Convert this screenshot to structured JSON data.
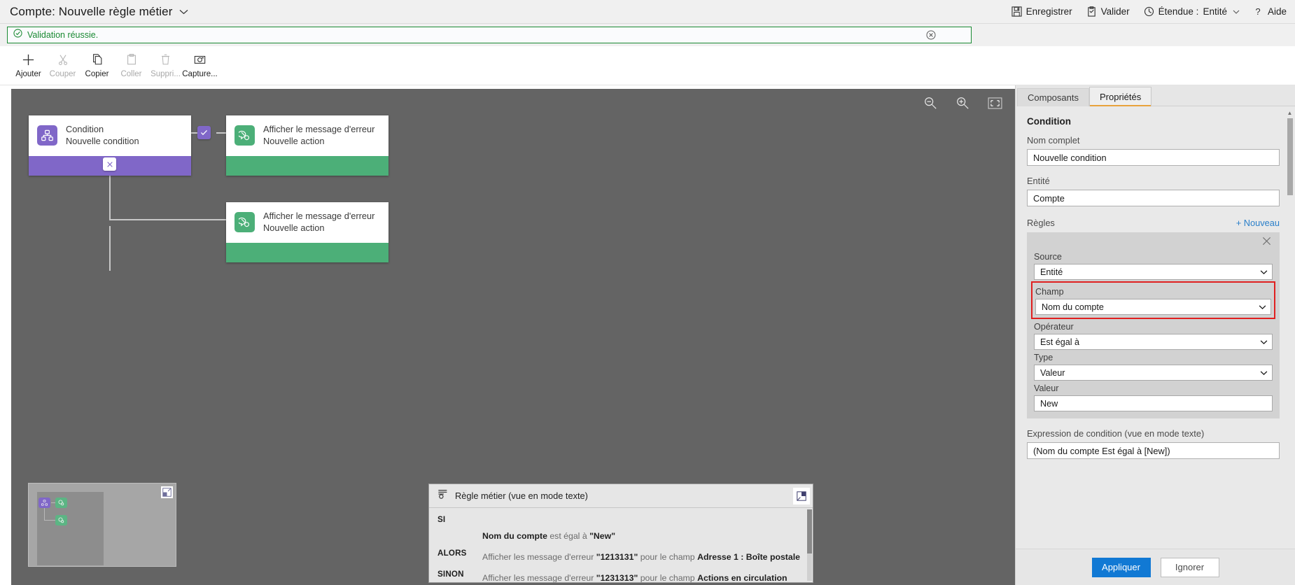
{
  "titlebar": {
    "title": "Compte: Nouvelle règle métier",
    "chevron": "chevron-down",
    "actions": [
      {
        "label": "Enregistrer",
        "icon": "save-icon"
      },
      {
        "label": "Valider",
        "icon": "validate-icon"
      },
      {
        "label": "Étendue :",
        "icon": "scope-icon",
        "value": "Entité",
        "chevron": "chevron-down"
      },
      {
        "label": "Aide",
        "icon": "help-icon"
      }
    ]
  },
  "validation": {
    "message": "Validation réussie.",
    "icon": "check-circle-icon",
    "close_icon": "close-circle-icon",
    "border_color": "#1a8a33",
    "text_color": "#1a8a33"
  },
  "commandbar": {
    "buttons": [
      {
        "label": "Ajouter",
        "icon": "plus-icon",
        "disabled": false
      },
      {
        "label": "Couper",
        "icon": "scissors-icon",
        "disabled": true
      },
      {
        "label": "Copier",
        "icon": "copy-icon",
        "disabled": false
      },
      {
        "label": "Coller",
        "icon": "paste-icon",
        "disabled": true
      },
      {
        "label": "Suppri...",
        "icon": "trash-icon",
        "disabled": true
      },
      {
        "label": "Capture...",
        "icon": "camera-icon",
        "disabled": false
      }
    ]
  },
  "canvas": {
    "background": "#646464",
    "tools": [
      {
        "name": "zoom-out-icon"
      },
      {
        "name": "zoom-in-icon"
      },
      {
        "name": "fit-to-screen-icon"
      }
    ],
    "nodes": [
      {
        "type": "condition",
        "icon": "condition-icon",
        "color": "#8067c8",
        "line1": "Condition",
        "line2": "Nouvelle condition"
      },
      {
        "type": "action",
        "icon": "show-error-message-icon",
        "color": "#4caf78",
        "line1": "Afficher le message d'erreur",
        "line2": "Nouvelle action"
      },
      {
        "type": "action",
        "icon": "show-error-message-icon",
        "color": "#4caf78",
        "line1": "Afficher le message d'erreur",
        "line2": "Nouvelle action"
      }
    ],
    "branch_badges": [
      {
        "name": "branch-true-badge",
        "glyph": "check"
      },
      {
        "name": "branch-false-badge",
        "glyph": "cross"
      }
    ]
  },
  "minimap": {
    "restore_icon": "restore-icon"
  },
  "textpanel": {
    "icon": "business-rule-icon",
    "title": "Règle métier (vue en mode texte)",
    "restore_icon": "restore-icon",
    "lines": [
      {
        "keyword": "SI",
        "prefix": "",
        "strong1": "Nom du compte",
        "mid": " est égal à ",
        "strong2": "\"New\"",
        "suffix": ""
      },
      {
        "keyword": "ALORS",
        "prefix": "Afficher les message d'erreur ",
        "strong1": "\"1213131\"",
        "mid": " pour le champ ",
        "strong2": "Adresse 1 : Boîte postale",
        "suffix": ""
      },
      {
        "keyword": "SINON",
        "prefix": "Afficher les message d'erreur ",
        "strong1": "\"1231313\"",
        "mid": " pour le champ ",
        "strong2": "Actions en circulation",
        "suffix": ""
      }
    ]
  },
  "rightpanel": {
    "tabs": [
      {
        "label": "Composants",
        "active": false
      },
      {
        "label": "Propriétés",
        "active": true
      }
    ],
    "section_title": "Condition",
    "fields": [
      {
        "label": "Nom complet",
        "value": "Nouvelle condition",
        "name": "full-name-field"
      },
      {
        "label": "Entité",
        "value": "Compte",
        "name": "entity-field"
      }
    ],
    "rules": {
      "title": "Règles",
      "new_label": "+ Nouveau",
      "close_icon": "close-icon",
      "selects": [
        {
          "label": "Source",
          "value": "Entité",
          "name": "source-select",
          "highlighted": false
        },
        {
          "label": "Champ",
          "value": "Nom du compte",
          "name": "field-select",
          "highlighted": true
        },
        {
          "label": "Opérateur",
          "value": "Est égal à",
          "name": "operator-select",
          "highlighted": false
        },
        {
          "label": "Type",
          "value": "Valeur",
          "name": "type-select",
          "highlighted": false
        }
      ],
      "value_field": {
        "label": "Valeur",
        "value": "New",
        "name": "value-field"
      }
    },
    "expression": {
      "label": "Expression de condition (vue en mode texte)",
      "value": "(Nom du compte Est égal à [New])"
    },
    "actions": {
      "apply": "Appliquer",
      "ignore": "Ignorer",
      "apply_color": "#1179d4"
    }
  }
}
